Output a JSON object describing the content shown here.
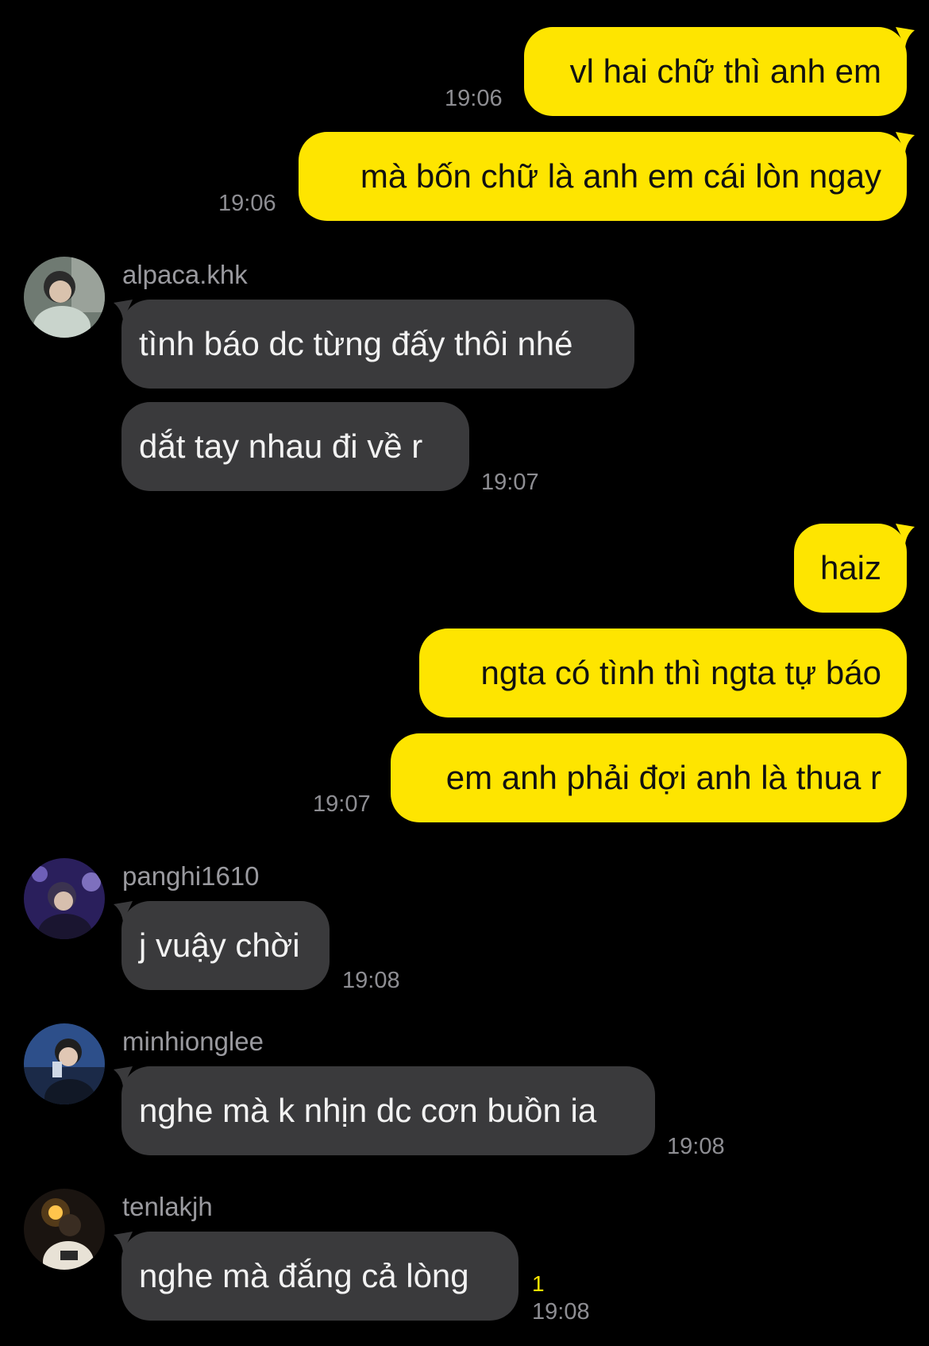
{
  "theme": {
    "background": "#000000",
    "outgoing_bubble": "#FEE500",
    "incoming_bubble": "#3A3A3C",
    "timestamp_color": "#8E8E93",
    "unread_color": "#FEE500"
  },
  "messages": [
    {
      "direction": "outgoing",
      "text": "vl hai chữ thì anh em",
      "time": "19:06"
    },
    {
      "direction": "outgoing",
      "text": "mà bốn chữ là anh em cái lòn ngay",
      "time": "19:06"
    },
    {
      "direction": "incoming",
      "sender": "alpaca.khk",
      "avatar_icon": "user-avatar-icon",
      "text": "tình báo dc từng đấy thôi nhé"
    },
    {
      "direction": "incoming",
      "text": "dắt tay nhau đi về r",
      "time": "19:07"
    },
    {
      "direction": "outgoing",
      "text": "haiz"
    },
    {
      "direction": "outgoing",
      "text": "ngta có tình thì ngta tự báo"
    },
    {
      "direction": "outgoing",
      "text": "em anh phải đợi anh là thua r",
      "time": "19:07"
    },
    {
      "direction": "incoming",
      "sender": "panghi1610",
      "avatar_icon": "user-avatar-icon",
      "text": "j vuậy chời",
      "time": "19:08"
    },
    {
      "direction": "incoming",
      "sender": "minhionglee",
      "avatar_icon": "user-avatar-icon",
      "text": "nghe mà k nhịn dc cơn buồn ia",
      "time": "19:08"
    },
    {
      "direction": "incoming",
      "sender": "tenlakjh",
      "avatar_icon": "user-avatar-icon",
      "text": "nghe mà đắng cả lòng",
      "time": "19:08",
      "unread_count": "1"
    }
  ]
}
